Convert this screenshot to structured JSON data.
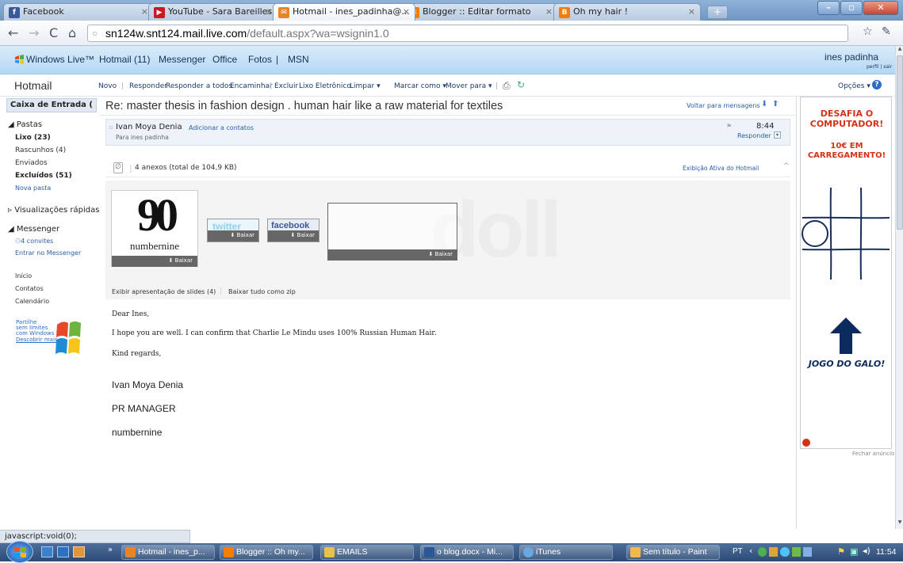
{
  "browser": {
    "tabs": [
      {
        "label": "Facebook",
        "icon": "facebook-icon",
        "color": "#3b5998",
        "glyph": "f"
      },
      {
        "label": "YouTube - Sara Bareilles ...",
        "icon": "youtube-icon",
        "color": "#cc181e",
        "glyph": "▶"
      },
      {
        "label": "Hotmail - ines_padinha@...",
        "icon": "hotmail-icon",
        "color": "#e8832a",
        "glyph": "✉"
      },
      {
        "label": "Blogger :: Editar formato",
        "icon": "blogger-icon",
        "color": "#f57d00",
        "glyph": "B"
      },
      {
        "label": "Oh my hair !",
        "icon": "blogger-icon",
        "color": "#f57d00",
        "glyph": "B"
      }
    ],
    "url_host": "sn124w.snt124.mail.live.com",
    "url_path": "/default.aspx?wa=wsignin1.0",
    "status": "javascript:void(0);"
  },
  "live": {
    "brand": "Windows Live™",
    "links": [
      "Hotmail (11)",
      "Messenger",
      "Office",
      "Fotos",
      "|",
      "MSN"
    ],
    "user": "ines padinha",
    "profile_links": "perfil | sair"
  },
  "hotmail": {
    "title": "Hotmail",
    "commands": [
      "Novo",
      "|",
      "Responder",
      "Responder a todos",
      "Encaminhar",
      "|",
      "Excluir",
      "Lixo Eletrônico",
      "Limpar ▾",
      "Marcar como ▾",
      "Mover para ▾",
      "|"
    ],
    "options": "Opções ▾"
  },
  "sidebar": {
    "inbox": "Caixa de Entrada (",
    "folders_header": "◢ Pastas",
    "folders": [
      {
        "label": "Lixo (23)",
        "bold": true
      },
      {
        "label": "Rascunhos (4)",
        "bold": false
      },
      {
        "label": "Enviados",
        "bold": false
      },
      {
        "label": "Excluídos (51)",
        "bold": true
      },
      {
        "label": "Nova pasta",
        "bold": false,
        "link": true
      }
    ],
    "quick_views": "▹ Visualizações rápidas",
    "messenger_header": "◢ Messenger",
    "invites": "4 convites",
    "messenger_link": "Entrar no Messenger",
    "links": [
      "Início",
      "Contatos",
      "Calendário"
    ],
    "promo": [
      "Partilhe",
      "sem limites",
      "com Windows 7",
      "Descobrir mais"
    ]
  },
  "message": {
    "subject": "Re: master thesis in fashion design . human hair like a raw material for textiles",
    "back_link": "Voltar para mensagens",
    "sender": "Ivan Moya Denia",
    "add_contact": "Adicionar a contatos",
    "to": "Para ines padinha",
    "time": "8:44",
    "reply": "Responder",
    "attachments_summary": "4 anexos (total de 104,9 KB)",
    "active_view": "Exibição Ativa do Hotmail",
    "attachments": [
      {
        "name": "numbernine",
        "logo": "90",
        "download": "Baixar"
      },
      {
        "name": "twitter",
        "download": "Baixar"
      },
      {
        "name": "facebook",
        "download": "Baixar"
      },
      {
        "name": "doll",
        "download": "Baixar"
      }
    ],
    "slideshow": "Exibir apresentação de slides (4)",
    "zip": "Baixar tudo como zip",
    "body": [
      "Dear Ines,",
      "I hope you are well. I can confirm that Charlie Le Mindu uses 100% Russian Human Hair.",
      "Kind regards,"
    ],
    "signature": [
      "Ivan Moya Denia",
      "PR MANAGER",
      "numbernine"
    ]
  },
  "ad": {
    "headline": "DESAFIA O COMPUTADOR!",
    "price": "10€ EM CARREGAMENTO!",
    "game": "JOGO DO GALO!",
    "close": "Fechar anúncio"
  },
  "taskbar": {
    "tasks": [
      {
        "label": "Hotmail - ines_p...",
        "color": "#e8832a"
      },
      {
        "label": "Blogger :: Oh my...",
        "color": "#f57d00"
      },
      {
        "label": "EMAILS",
        "color": "#e7c14a"
      },
      {
        "label": "o blog.docx - Mi...",
        "color": "#2b5797"
      },
      {
        "label": "iTunes",
        "color": "#6aa6e0"
      },
      {
        "label": "Sem título - Paint",
        "color": "#f2b84b"
      }
    ],
    "lang": "PT",
    "clock": "11:54"
  }
}
